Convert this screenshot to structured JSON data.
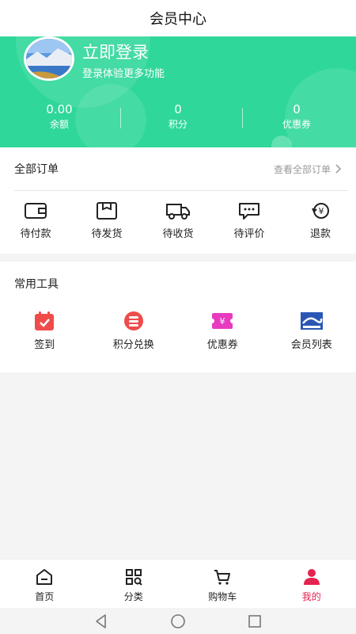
{
  "header": {
    "title": "会员中心"
  },
  "profile": {
    "login_title": "立即登录",
    "login_subtitle": "登录体验更多功能"
  },
  "stats": [
    {
      "value": "0.00",
      "label": "余额"
    },
    {
      "value": "0",
      "label": "积分"
    },
    {
      "value": "0",
      "label": "优惠券"
    }
  ],
  "orders": {
    "title": "全部订单",
    "view_all": "查看全部订单",
    "items": [
      {
        "label": "待付款",
        "icon": "wallet-icon"
      },
      {
        "label": "待发货",
        "icon": "box-icon"
      },
      {
        "label": "待收货",
        "icon": "truck-icon"
      },
      {
        "label": "待评价",
        "icon": "comment-icon"
      },
      {
        "label": "退款",
        "icon": "refund-icon"
      }
    ]
  },
  "tools": {
    "title": "常用工具",
    "items": [
      {
        "label": "签到",
        "icon": "calendar-icon",
        "color": "#f04b4b"
      },
      {
        "label": "积分兑换",
        "icon": "coins-icon",
        "color": "#f04b4b"
      },
      {
        "label": "优惠券",
        "icon": "coupon-icon",
        "color": "#e83bc0"
      },
      {
        "label": "会员列表",
        "icon": "member-list-icon",
        "color": "#2a57b5"
      }
    ]
  },
  "tabbar": {
    "items": [
      {
        "label": "首页",
        "icon": "home-icon"
      },
      {
        "label": "分类",
        "icon": "category-icon"
      },
      {
        "label": "购物车",
        "icon": "cart-icon"
      },
      {
        "label": "我的",
        "icon": "user-icon",
        "active": true
      }
    ]
  },
  "colors": {
    "brand": "#2fd79a",
    "active_tab": "#e5234f"
  }
}
